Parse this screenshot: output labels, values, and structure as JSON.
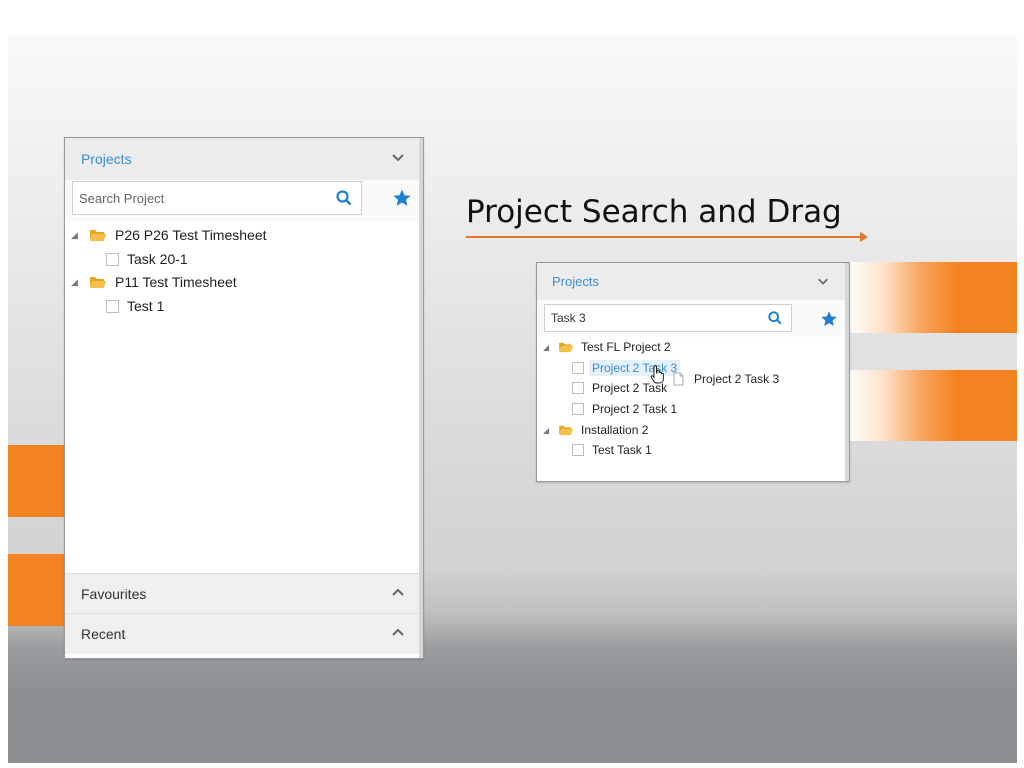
{
  "slide": {
    "headline": "Project Search and Drag",
    "accent_color": "#f58220"
  },
  "left_panel": {
    "header": "Projects",
    "search_placeholder": "Search Project",
    "tree": [
      {
        "label": "P26 P26 Test Timesheet",
        "children": [
          "Task 20-1"
        ]
      },
      {
        "label": "P11 Test Timesheet",
        "children": [
          "Test 1"
        ]
      }
    ],
    "favourites_label": "Favourites",
    "recent_label": "Recent"
  },
  "right_panel": {
    "header": "Projects",
    "search_value": "Task 3",
    "tree": [
      {
        "label": "Test FL Project 2",
        "children": [
          "Project 2 Task 3",
          "Project 2 Task",
          "Project 2 Task 1"
        ]
      },
      {
        "label": "Installation 2",
        "children": [
          "Test Task 1"
        ]
      }
    ],
    "drag_ghost_label": "Project 2 Task 3"
  },
  "icons": {
    "search": "search-icon",
    "favourite": "star-icon",
    "folder": "folder-open-icon",
    "expand": "expand-triangle-icon",
    "collapse": "chevron-down-icon",
    "expand_section": "chevron-up-icon",
    "cursor": "hand-cursor-icon",
    "drag_item": "document-icon"
  },
  "colors": {
    "link_blue": "#3a8fd0",
    "icon_blue": "#1f7fd0",
    "folder_yellow": "#f2b632",
    "highlight_bg": "#e4f0fb"
  }
}
